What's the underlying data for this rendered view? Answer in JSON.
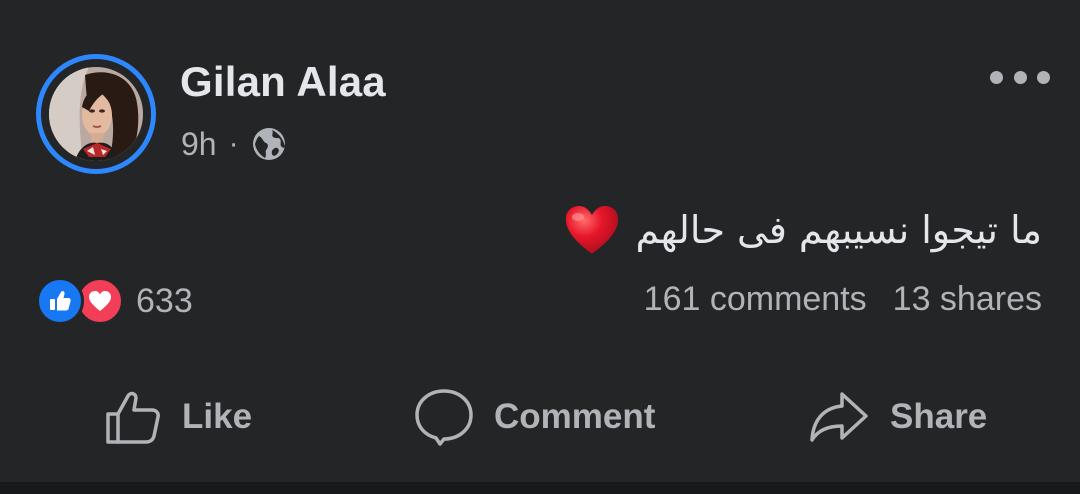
{
  "post": {
    "author": "Gilan Alaa",
    "time": "9h",
    "separator": "·",
    "privacy_icon": "globe-icon",
    "text": "ما تيجوا نسيبهم فى حالهم",
    "emoji": "red-heart",
    "reactions": {
      "types": [
        "like",
        "love"
      ],
      "count": "633"
    },
    "comments_label": "161 comments",
    "shares_label": "13 shares"
  },
  "actions": {
    "like_label": "Like",
    "comment_label": "Comment",
    "share_label": "Share"
  },
  "colors": {
    "background": "#242526",
    "text_primary": "#e4e6eb",
    "text_secondary": "#b0b3b8",
    "story_ring": "#2d88ff",
    "like_blue": "#1877f2",
    "love_red": "#f33e58"
  }
}
